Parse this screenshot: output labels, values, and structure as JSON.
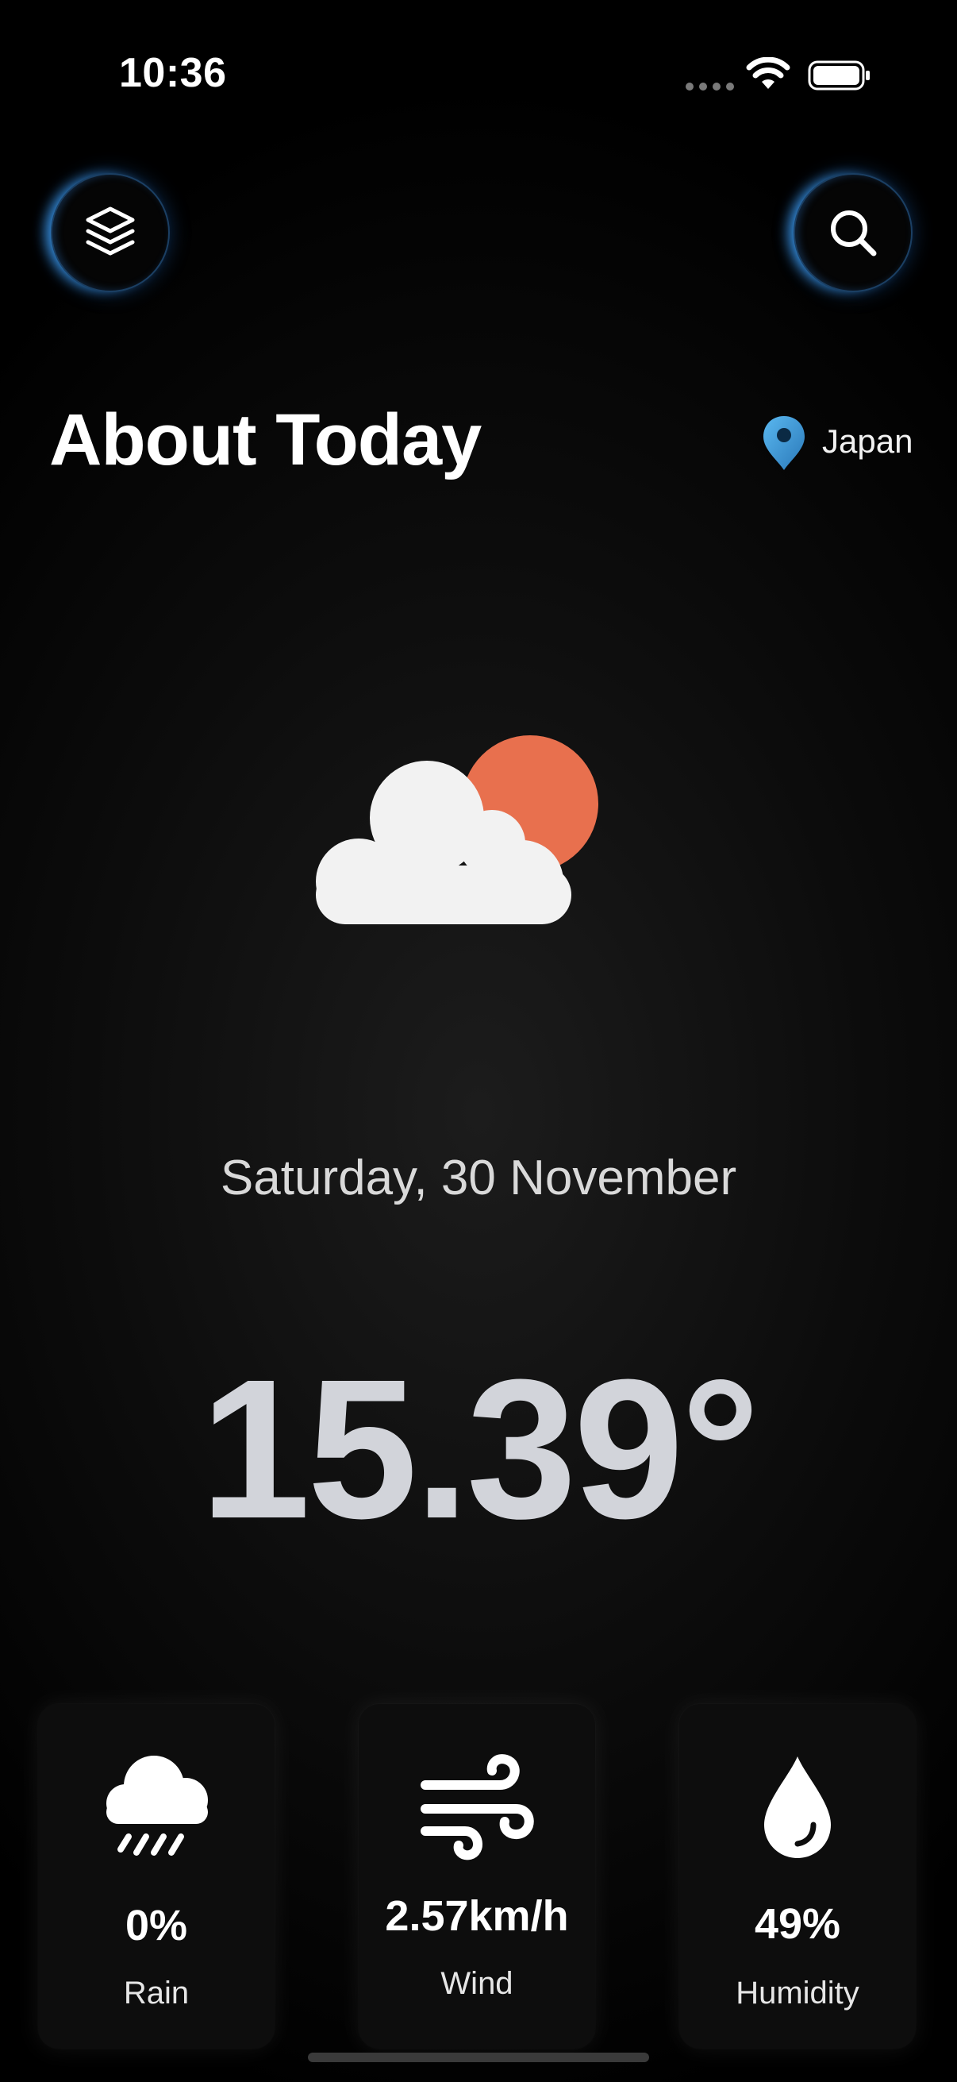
{
  "status_bar": {
    "time": "10:36"
  },
  "header": {
    "title": "About Today",
    "location": "Japan",
    "layers_icon": "layers-icon",
    "search_icon": "search-icon"
  },
  "weather": {
    "condition_icon": "partly-cloudy-icon",
    "date": "Saturday, 30 November",
    "temperature": "15.39°"
  },
  "stats": [
    {
      "icon": "rain-cloud-icon",
      "value": "0%",
      "label": "Rain"
    },
    {
      "icon": "wind-icon",
      "value": "2.57km/h",
      "label": "Wind"
    },
    {
      "icon": "droplet-icon",
      "value": "49%",
      "label": "Humidity"
    }
  ],
  "colors": {
    "background": "#000000",
    "accent_glow": "#40a5ff",
    "sun": "#e8704e",
    "cloud": "#f2f2f2",
    "temperature": "#d2d4da"
  }
}
